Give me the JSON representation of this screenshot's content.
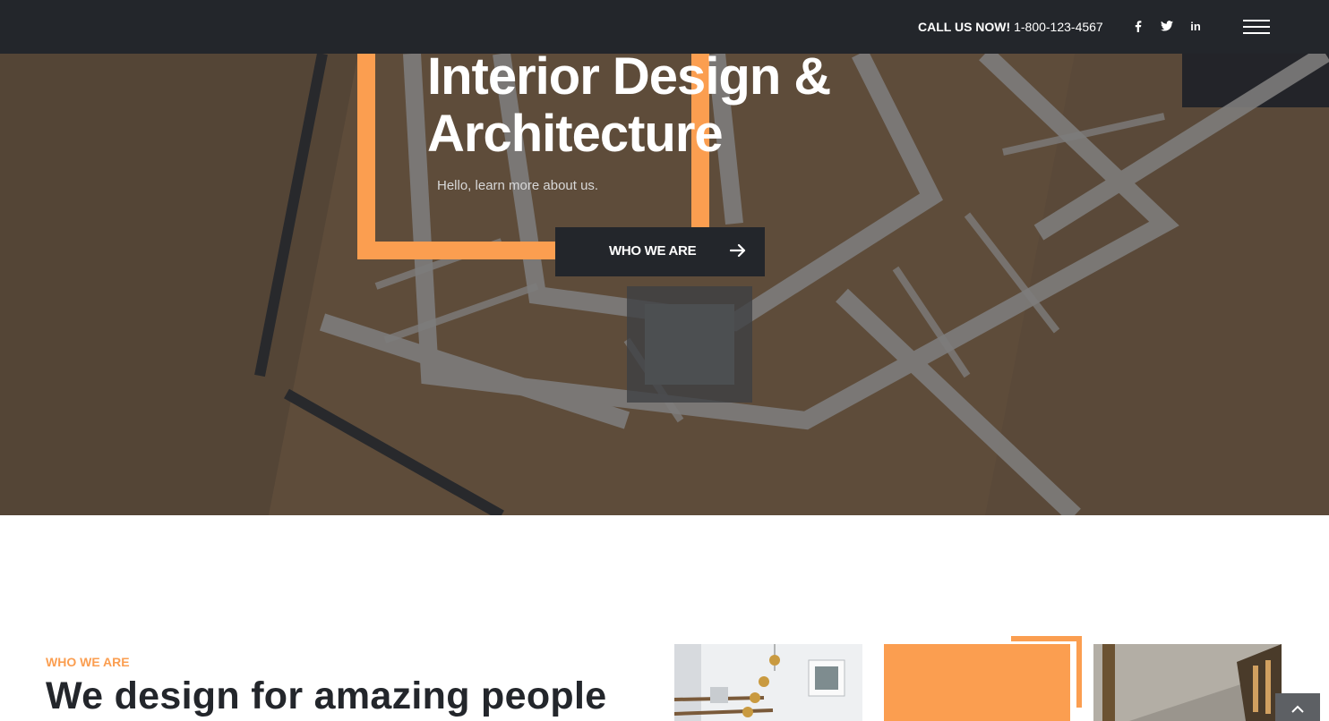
{
  "header": {
    "call_label": "CALL US NOW!",
    "phone": "1-800-123-4567",
    "social": [
      {
        "name": "facebook-icon"
      },
      {
        "name": "twitter-icon"
      },
      {
        "name": "linkedin-icon",
        "glyph": "in"
      }
    ],
    "menu_icon": "hamburger-menu-icon"
  },
  "hero": {
    "title_line1": "Interior Design &",
    "title_line2": "Architecture",
    "subtitle": "Hello, learn more about us.",
    "cta_label": "WHO WE ARE",
    "cta_icon": "arrow-right-icon"
  },
  "about": {
    "eyebrow": "WHO WE ARE",
    "title": "We design for amazing people"
  },
  "scroll_top_icon": "chevron-up-icon",
  "colors": {
    "accent": "#fb9e50",
    "dark": "#23262b"
  }
}
